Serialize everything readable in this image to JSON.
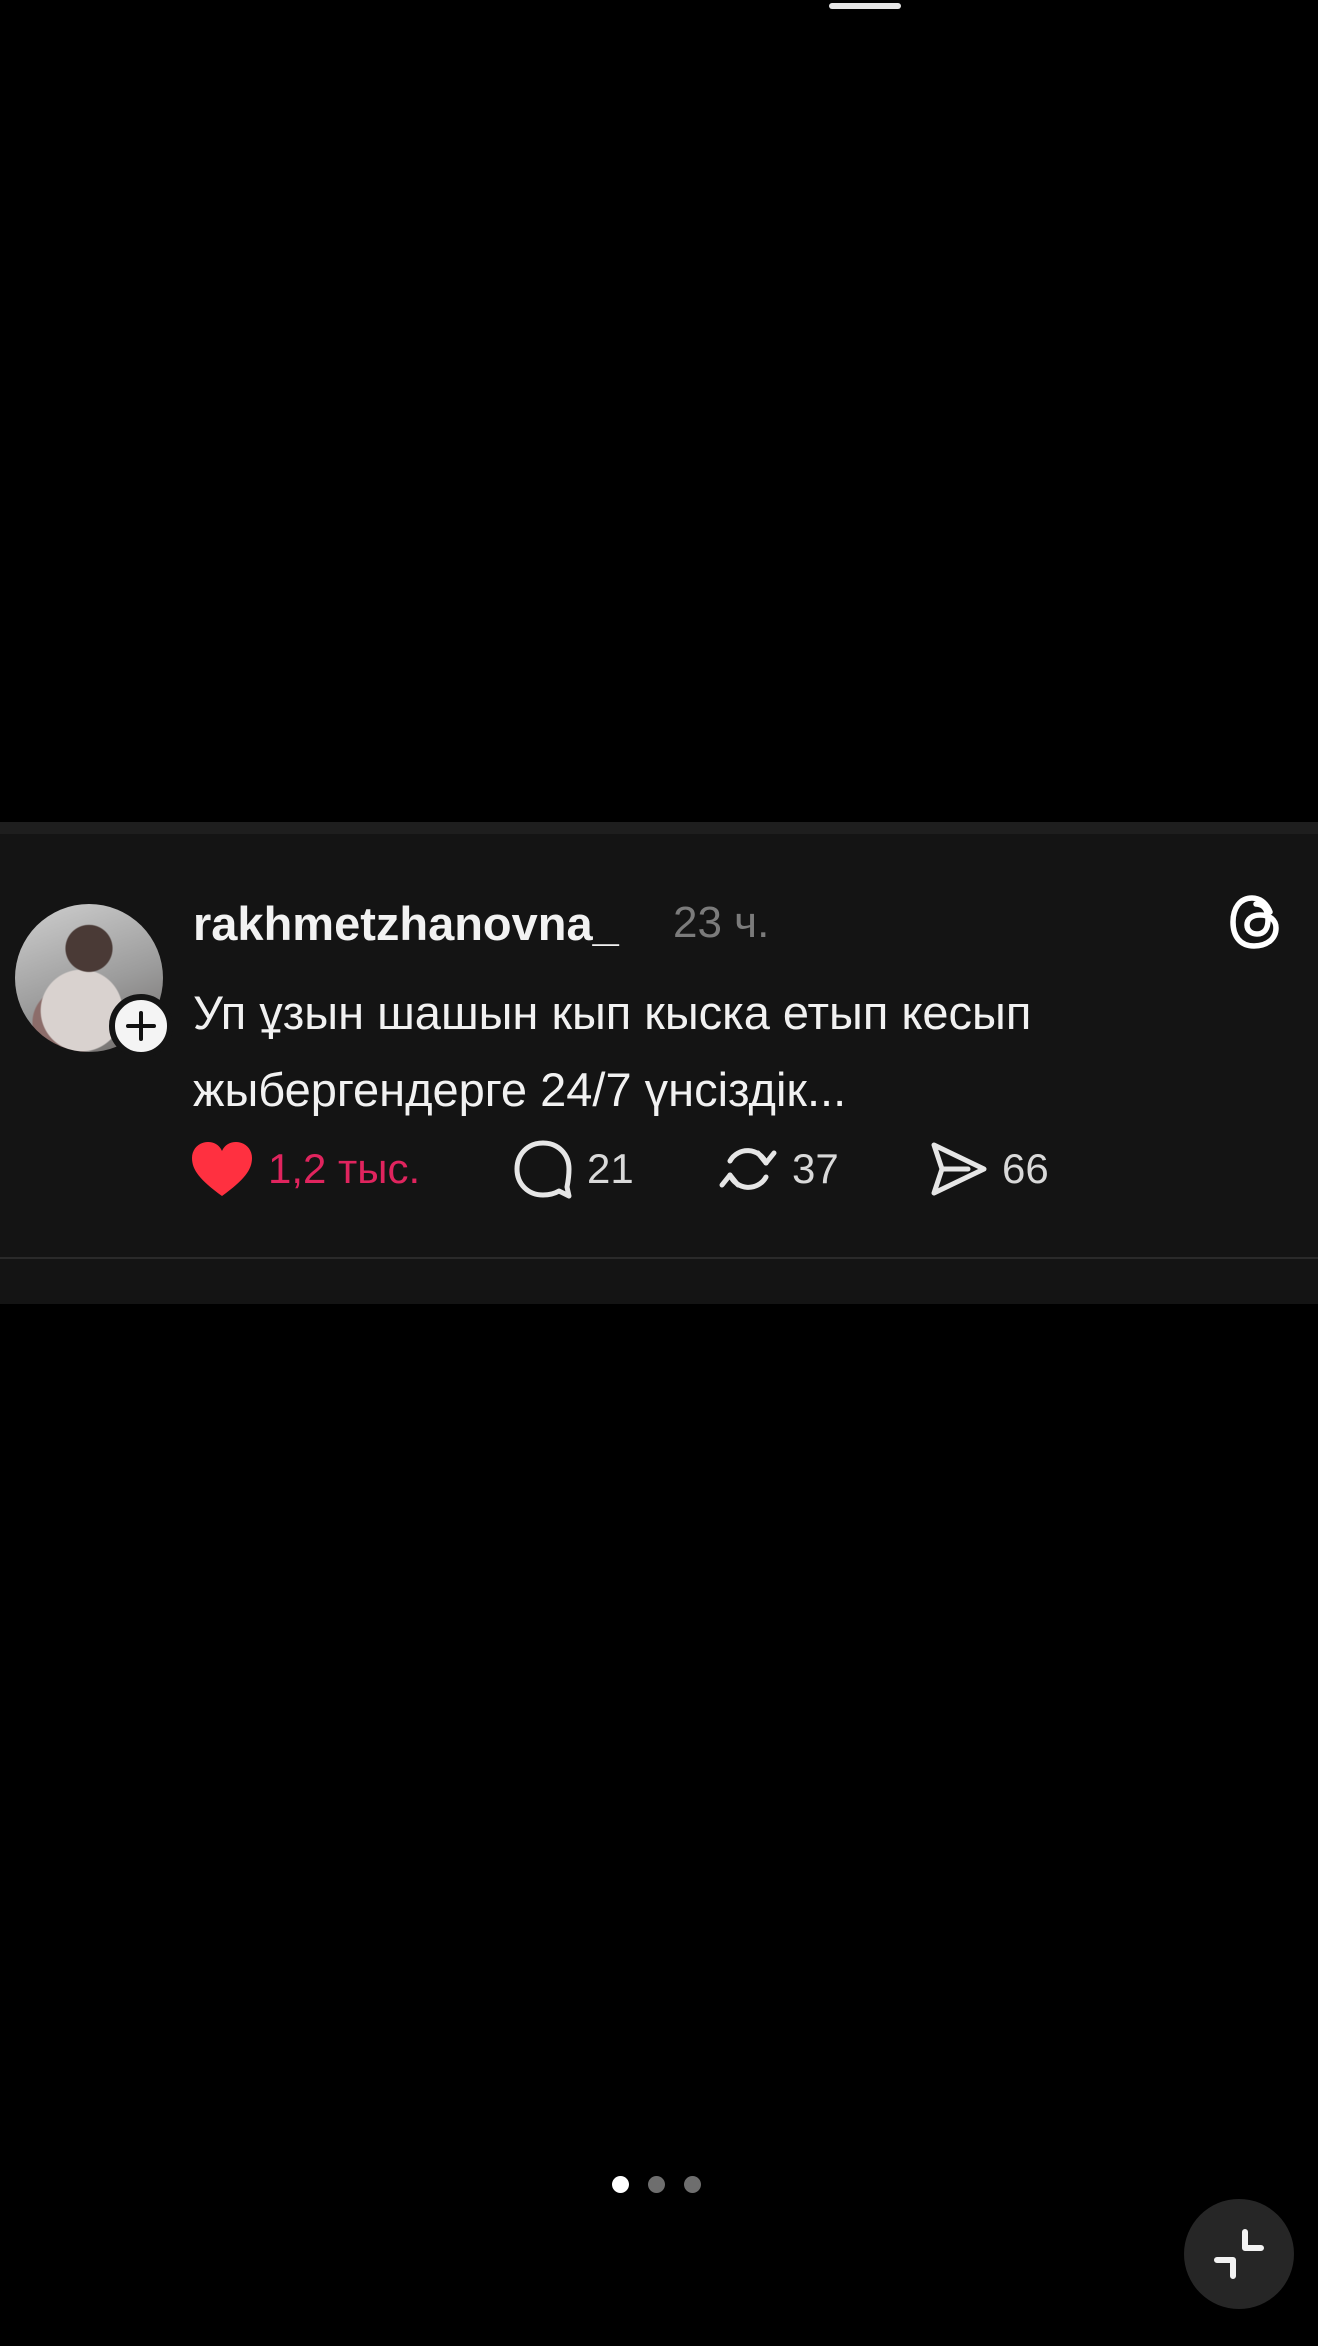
{
  "post": {
    "username": "rakhmetzhanovna_",
    "timestamp": "23 ч.",
    "text": "Уп ұзын шашын кып кыска етып кесып жыбергендерге 24/7 үнсіздік...",
    "likes": "1,2 тыс.",
    "comments": "21",
    "reposts": "37",
    "shares": "66",
    "liked": true,
    "like_color": "#e0245e"
  },
  "icons": {
    "follow": "plus-icon",
    "brand": "threads-logo-icon",
    "like": "heart-icon",
    "comment": "comment-bubble-icon",
    "repost": "repost-icon",
    "share": "send-icon",
    "collapse": "collapse-icon"
  },
  "pager": {
    "count": 3,
    "active": 1
  }
}
